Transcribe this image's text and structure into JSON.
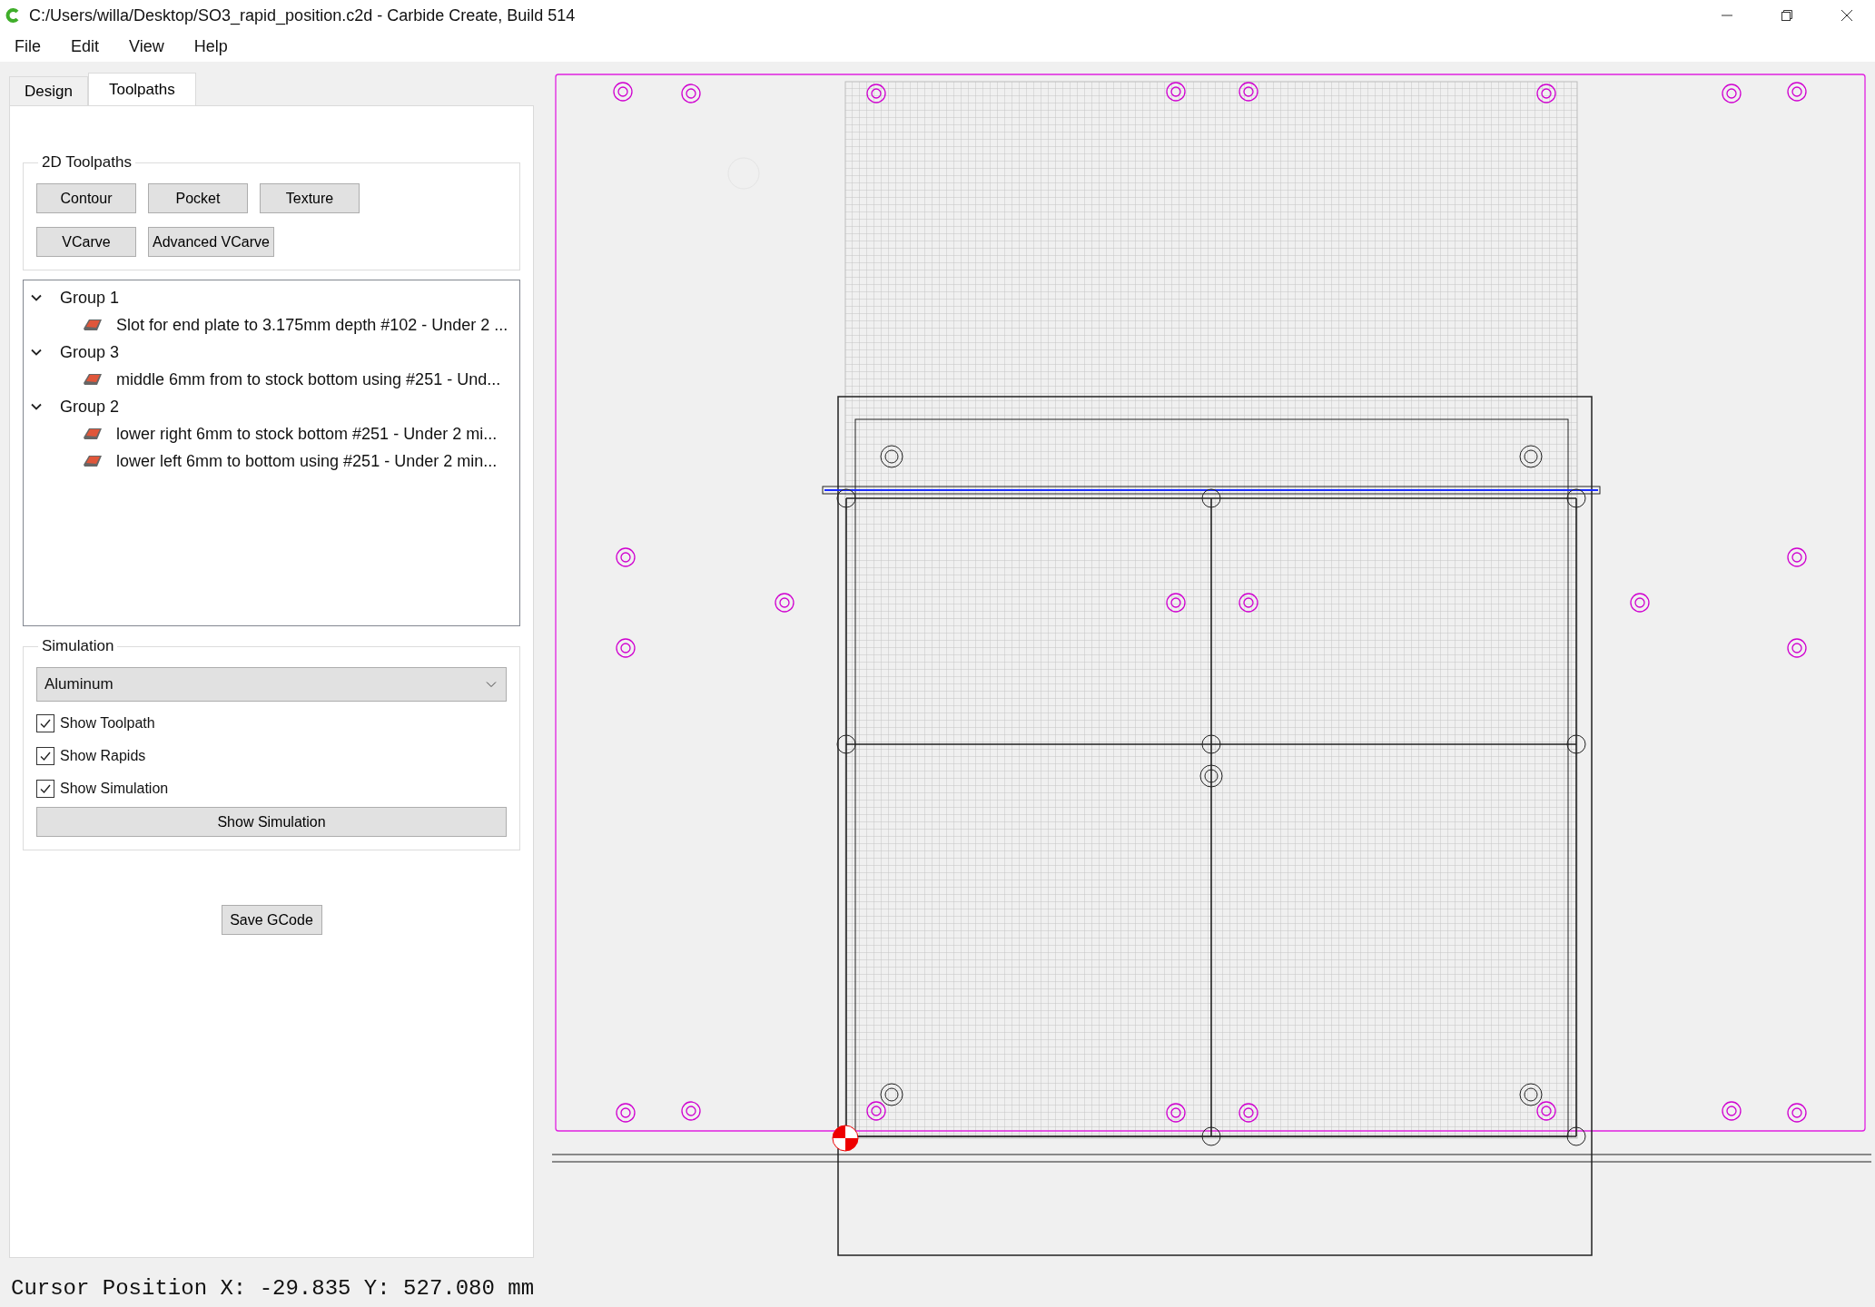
{
  "window": {
    "title": "C:/Users/willa/Desktop/SO3_rapid_position.c2d - Carbide Create, Build 514"
  },
  "menu": [
    "File",
    "Edit",
    "View",
    "Help"
  ],
  "tabs": [
    {
      "label": "Design",
      "selected": false
    },
    {
      "label": "Toolpaths",
      "selected": true
    }
  ],
  "toolpaths_2d": {
    "title": "2D Toolpaths",
    "buttons": [
      "Contour",
      "Pocket",
      "Texture",
      "VCarve",
      "Advanced VCarve"
    ]
  },
  "toolpath_tree": [
    {
      "label": "Group 1",
      "expanded": true,
      "children": [
        {
          "label": "Slot for end plate to 3.175mm depth #102 - Under 2 ..."
        }
      ]
    },
    {
      "label": "Group 3",
      "expanded": true,
      "children": [
        {
          "label": "middle 6mm from to stock bottom using #251 - Und..."
        }
      ]
    },
    {
      "label": "Group 2",
      "expanded": true,
      "children": [
        {
          "label": "lower right 6mm to stock bottom #251 - Under 2 mi..."
        },
        {
          "label": "lower left 6mm to bottom using #251 - Under 2 min..."
        }
      ]
    }
  ],
  "simulation": {
    "title": "Simulation",
    "material": "Aluminum",
    "checkboxes": [
      {
        "label": "Show Toolpath",
        "checked": true
      },
      {
        "label": "Show Rapids",
        "checked": true
      },
      {
        "label": "Show Simulation",
        "checked": true
      }
    ],
    "button": "Show Simulation"
  },
  "save_button": "Save GCode",
  "status_bar": "Cursor Position X: -29.835 Y: 527.080 mm"
}
